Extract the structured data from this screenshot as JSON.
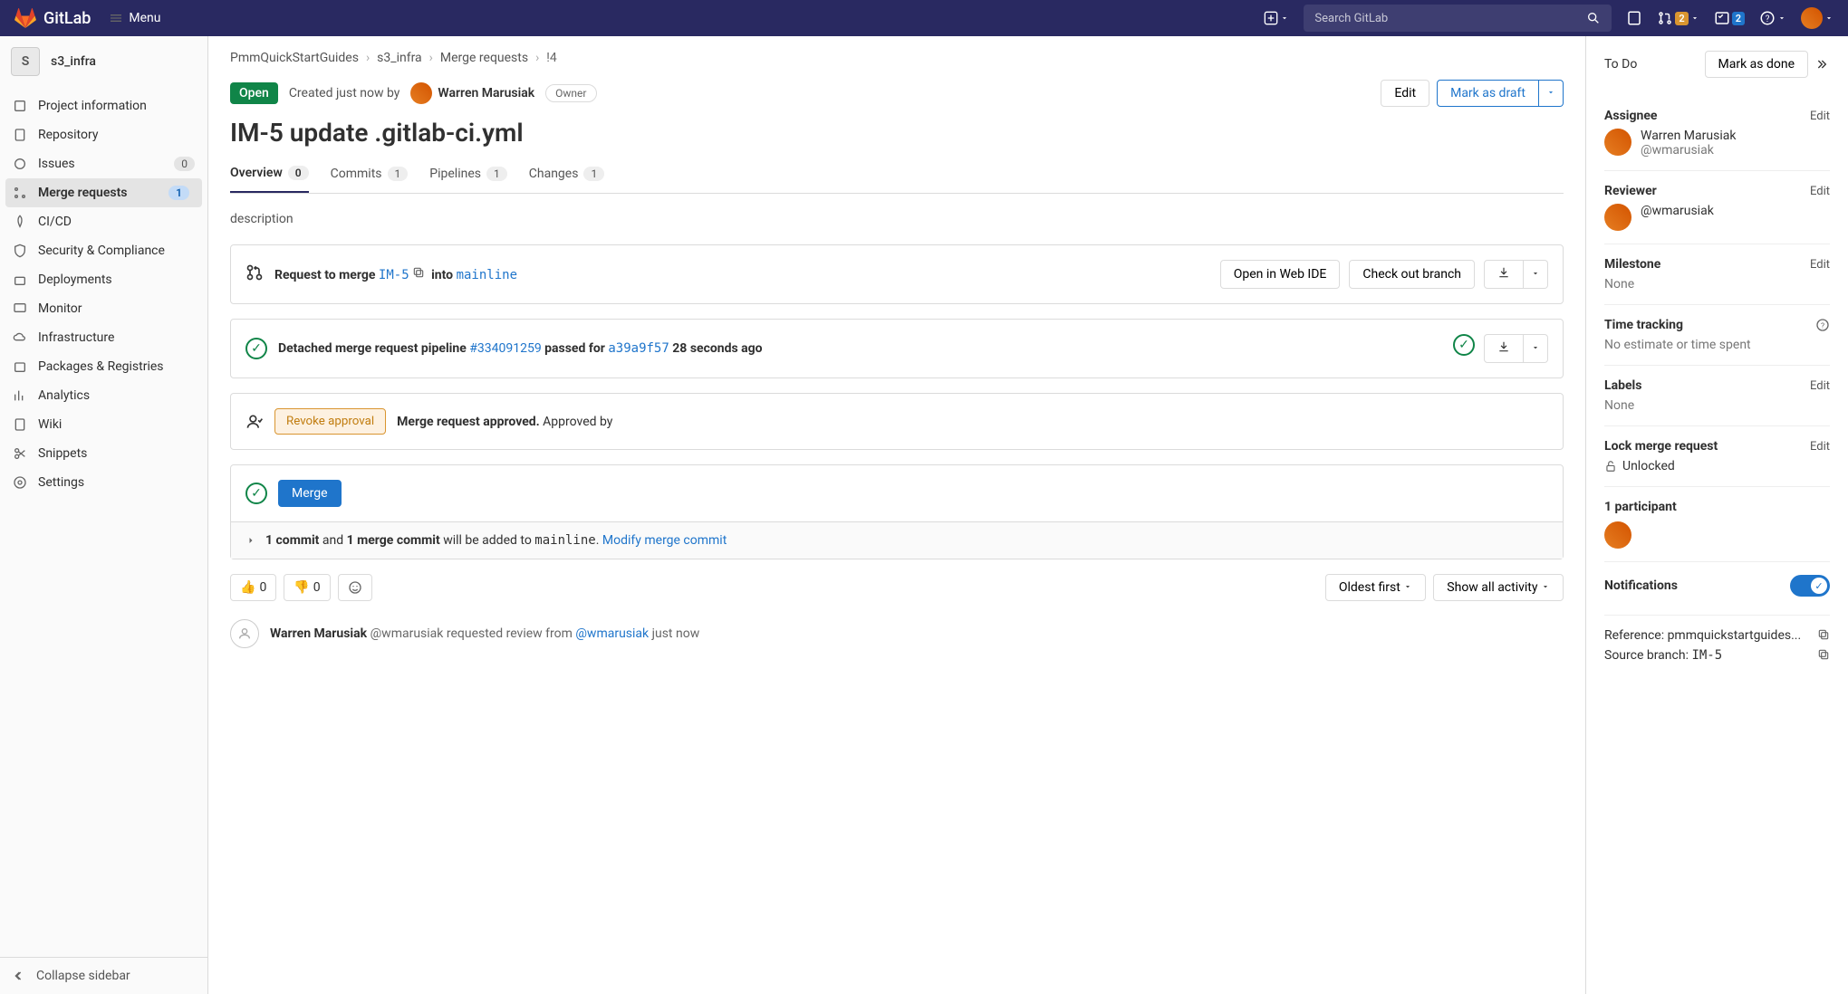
{
  "topbar": {
    "logo": "GitLab",
    "menu": "Menu",
    "search_placeholder": "Search GitLab",
    "mr_badge": "2",
    "todo_badge": "2"
  },
  "sidebar": {
    "project_initial": "S",
    "project_name": "s3_infra",
    "items": [
      {
        "label": "Project information"
      },
      {
        "label": "Repository"
      },
      {
        "label": "Issues",
        "badge": "0"
      },
      {
        "label": "Merge requests",
        "badge": "1"
      },
      {
        "label": "CI/CD"
      },
      {
        "label": "Security & Compliance"
      },
      {
        "label": "Deployments"
      },
      {
        "label": "Monitor"
      },
      {
        "label": "Infrastructure"
      },
      {
        "label": "Packages & Registries"
      },
      {
        "label": "Analytics"
      },
      {
        "label": "Wiki"
      },
      {
        "label": "Snippets"
      },
      {
        "label": "Settings"
      }
    ],
    "collapse": "Collapse sidebar"
  },
  "crumbs": {
    "items": [
      "PmmQuickStartGuides",
      "s3_infra",
      "Merge requests",
      "!4"
    ]
  },
  "mr": {
    "status": "Open",
    "created_prefix": "Created just now by",
    "author_name": "Warren Marusiak",
    "role": "Owner",
    "actions": {
      "edit": "Edit",
      "draft": "Mark as draft"
    },
    "title": "IM-5 update .gitlab-ci.yml",
    "tabs": {
      "overview": "Overview",
      "overview_n": "0",
      "commits": "Commits",
      "commits_n": "1",
      "pipelines": "Pipelines",
      "pipelines_n": "1",
      "changes": "Changes",
      "changes_n": "1"
    },
    "description": "description"
  },
  "merge_block": {
    "request": "Request to merge",
    "source": "IM-5",
    "into": "into",
    "target": "mainline",
    "open_ide": "Open in Web IDE",
    "checkout": "Check out branch"
  },
  "pipeline": {
    "prefix": "Detached merge request pipeline ",
    "id": "#334091259",
    "passed": " passed for ",
    "sha": "a39a9f57",
    "ago": " 28 seconds ago"
  },
  "approval": {
    "revoke": "Revoke approval",
    "approved": "Merge request approved.",
    "by": " Approved by "
  },
  "merge": {
    "button": "Merge"
  },
  "commit_info": {
    "bold1": "1 commit",
    "mid": " and ",
    "bold2": "1 merge commit",
    "rest": " will be added to ",
    "branch": "mainline",
    "period": ". ",
    "modify": "Modify merge commit"
  },
  "reactions": {
    "up": "0",
    "down": "0",
    "sort": "Oldest first",
    "filter": "Show all activity"
  },
  "activity": {
    "name": "Warren Marusiak",
    "handle": " @wmarusiak requested review from ",
    "target": "@wmarusiak",
    "time": " just now"
  },
  "rightbar": {
    "todo": "To Do",
    "mark_done": "Mark as done",
    "assignee": {
      "title": "Assignee",
      "edit": "Edit",
      "name": "Warren Marusiak",
      "handle": "@wmarusiak"
    },
    "reviewer": {
      "title": "Reviewer",
      "edit": "Edit",
      "handle": "@wmarusiak"
    },
    "milestone": {
      "title": "Milestone",
      "edit": "Edit",
      "value": "None"
    },
    "time": {
      "title": "Time tracking",
      "value": "No estimate or time spent"
    },
    "labels": {
      "title": "Labels",
      "edit": "Edit",
      "value": "None"
    },
    "lock": {
      "title": "Lock merge request",
      "edit": "Edit",
      "value": "Unlocked"
    },
    "participants": "1 participant",
    "notifications": "Notifications",
    "reference": {
      "label": "Reference: ",
      "value": "pmmquickstartguides..."
    },
    "source": {
      "label": "Source branch: ",
      "value": "IM-5"
    }
  }
}
